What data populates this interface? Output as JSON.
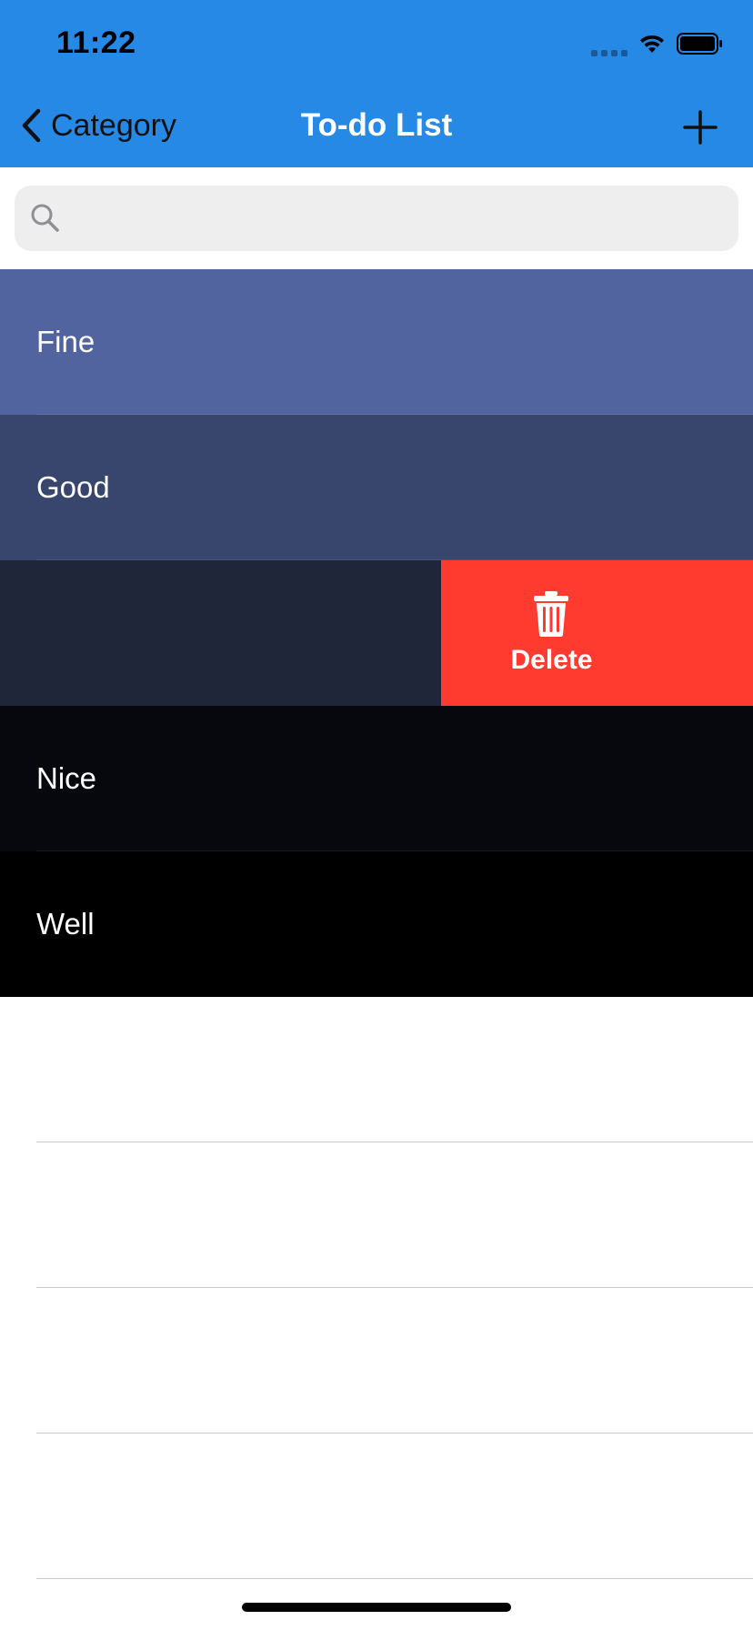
{
  "status_bar": {
    "time": "11:22"
  },
  "nav": {
    "back_label": "Category",
    "title": "To-do List",
    "add_icon": "plus-icon"
  },
  "search": {
    "placeholder": "",
    "value": ""
  },
  "colors": {
    "nav_bg": "#2789E6",
    "delete": "#FF3B30",
    "row_1": "#5164A0",
    "row_2": "#38466E",
    "row_3": "#1F263A",
    "row_4": "#06080D",
    "row_5": "#000000"
  },
  "list": {
    "items": [
      {
        "label": "Fine"
      },
      {
        "label": "Good"
      },
      {
        "label": ""
      },
      {
        "label": "Nice"
      },
      {
        "label": "Well"
      }
    ],
    "swipe_action": {
      "label": "Delete",
      "icon": "trash-icon"
    }
  }
}
